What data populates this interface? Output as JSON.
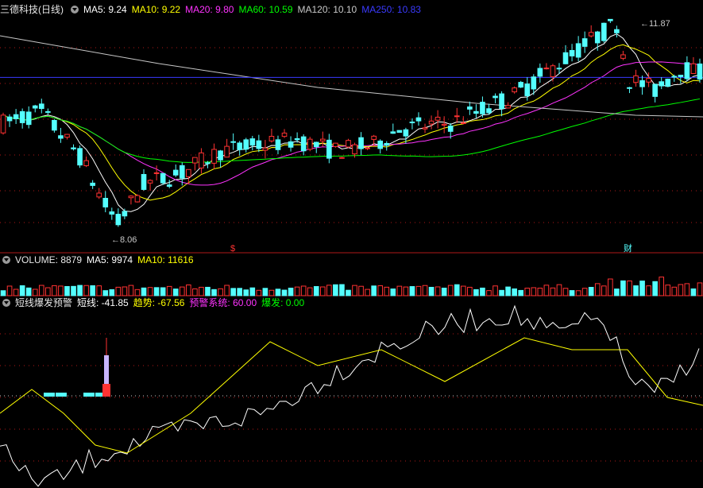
{
  "main_panel": {
    "title": "三德科技(日线)",
    "ma": [
      {
        "label": "MA5: 9.24",
        "color": "#ffffff"
      },
      {
        "label": "MA10: 9.22",
        "color": "#ffff00"
      },
      {
        "label": "MA20: 9.80",
        "color": "#ff33ff"
      },
      {
        "label": "MA60: 10.59",
        "color": "#00ff00"
      },
      {
        "label": "MA120: 10.10",
        "color": "#c8c8c8"
      },
      {
        "label": "MA250: 10.83",
        "color": "#3a3aff"
      }
    ],
    "high_label": "11.87",
    "low_label": "8.06",
    "marker_s": "$",
    "marker_cai": "财"
  },
  "volume_panel": {
    "label": "VOLUME: 8879",
    "ma5": "MA5: 9974",
    "ma10": "MA10: 11616"
  },
  "indicator_panel": {
    "name": "短线爆发预警",
    "items": [
      {
        "label": "短线: -41.85",
        "color": "#ffffff"
      },
      {
        "label": "趋势: -67.56",
        "color": "#ffff00"
      },
      {
        "label": "预警系统: 60.00",
        "color": "#ff33ff"
      },
      {
        "label": "爆发: 0.00",
        "color": "#00ff00"
      }
    ]
  },
  "colors": {
    "up": "#ff3232",
    "down": "#54ffff",
    "background": "#000000",
    "grid": "#b01818"
  },
  "chart_data": {
    "type": "candlestick",
    "series_note": "daily K-line with moving averages, volume and indicator sub-panels",
    "price_high": 11.87,
    "price_low": 8.06,
    "ma_values": {
      "MA5": 9.24,
      "MA10": 9.22,
      "MA20": 9.8,
      "MA60": 10.59,
      "MA120": 10.1,
      "MA250": 10.83
    },
    "volume": 8879,
    "volume_ma5": 9974,
    "volume_ma10": 11616,
    "indicator": {
      "短线": -41.85,
      "趋势": -67.56,
      "预警系统": 60.0,
      "爆发": 0.0
    }
  }
}
